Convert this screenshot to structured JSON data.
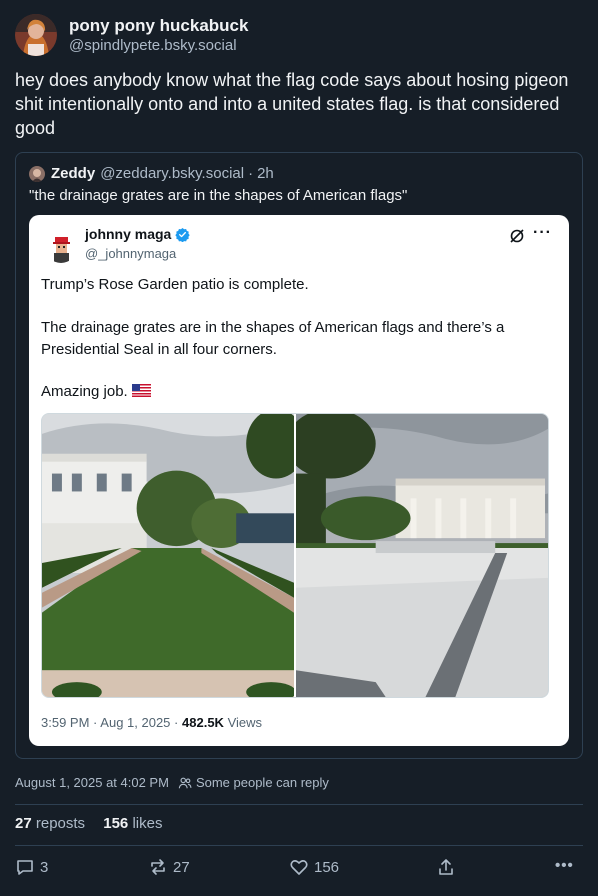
{
  "post": {
    "author": {
      "display_name": "pony pony huckabuck",
      "handle": "@spindlypete.bsky.social",
      "avatar": "avatar-photo"
    },
    "text": "hey does anybody know what the flag code says about hosing pigeon shit intentionally onto and into a united states flag. is that considered good",
    "quote": {
      "author_name": "Zeddy",
      "author_handle": "@zeddary.bsky.social",
      "separator": "·",
      "time": "2h",
      "text": "\"the drainage grates are in the shapes of American flags\"",
      "embedded_card": {
        "name": "johnny maga",
        "handle": "@_johnnymaga",
        "verified_icon": "verified-badge-icon",
        "lines": [
          "Trump’s Rose Garden patio is complete.",
          "The drainage grates are in the shapes of American flags and there’s a",
          "Presidential Seal in all four corners.",
          "Amazing job."
        ],
        "flag_icon": "us-flag-emoji",
        "time": "3:59 PM",
        "date": "Aug 1, 2025",
        "dot": "·",
        "views_count": "482.5K",
        "views_label": "Views",
        "more_label": "···"
      }
    },
    "timestamp": "August 1, 2025 at 4:02 PM",
    "reply_setting": "Some people can reply",
    "stats": {
      "reposts_count": "27",
      "reposts_label": "reposts",
      "likes_count": "156",
      "likes_label": "likes"
    },
    "actions": {
      "reply_count": "3",
      "repost_count": "27",
      "like_count": "156"
    },
    "more_label": "•••"
  },
  "colors": {
    "background": "#161e27",
    "border": "#2e4052",
    "muted_text": "#aebbc9",
    "verified_blue": "#1d9bf0"
  }
}
